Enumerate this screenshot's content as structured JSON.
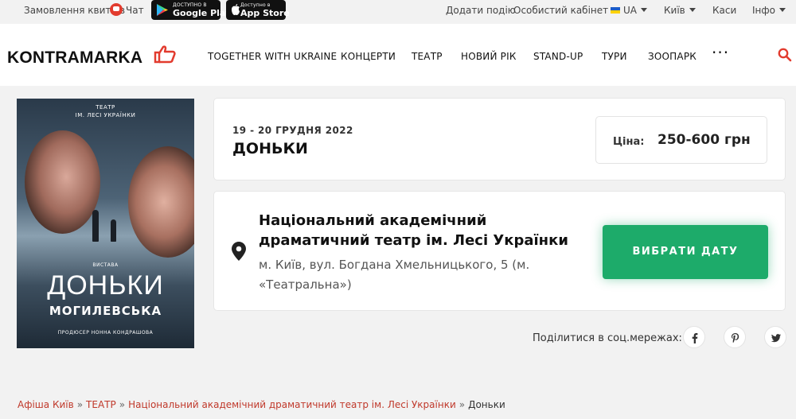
{
  "topbar": {
    "ticket_label": "Замовлення квитків",
    "chat_label": "Чат",
    "google_play": {
      "small": "ДОСТУПНО В",
      "big": "Google Play"
    },
    "app_store": {
      "small": "Доступно в",
      "big": "App Store"
    },
    "add_event": "Додати подію",
    "cabinet": "Особистий кабінет",
    "language": "UA",
    "city": "Київ",
    "cashier": "Каси",
    "info": "Інфо"
  },
  "header": {
    "logo": "KONTRAMARKA",
    "nav": [
      "TOGETHER WITH UKRAINE",
      "КОНЦЕРТИ",
      "ТЕАТР",
      "НОВИЙ РІК",
      "STAND-UP",
      "ТУРИ",
      "ЗООПАРК"
    ],
    "more": "···"
  },
  "poster": {
    "line1": "ТЕАТР",
    "line2": "ІМ. ЛЕСІ УКРАЇНКИ",
    "line3": "ВИСТАВА",
    "title": "ДОНЬКИ",
    "subtitle": "МОГИЛЕВСЬКА",
    "producer": "ПРОДЮСЕР     НОННА КОНДРАШОВА"
  },
  "event": {
    "date": "19 - 20 ГРУДНЯ 2022",
    "title": "ДОНЬКИ",
    "price_label": "Ціна:",
    "price_value": "250-600 грн"
  },
  "venue": {
    "name": "Національний академічний драматичний театр ім. Лесі Українки",
    "address": "м. Київ, вул. Богдана Хмельницького, 5 (м. «Театральна»)",
    "button": "ВИБРАТИ ДАТУ"
  },
  "share": {
    "label": "Поділитися в соц.мережах:",
    "icons": [
      "facebook-icon",
      "pinterest-icon",
      "twitter-icon"
    ]
  },
  "breadcrumb": {
    "items": [
      "Афіша Київ",
      "ТЕАТР",
      "Національний академічний драматичний театр ім. Лесі Українки"
    ],
    "current": "Доньки"
  },
  "colors": {
    "accent_green": "#1dab6a",
    "link_red": "#c0392b",
    "brand_red": "#e23b2e"
  }
}
